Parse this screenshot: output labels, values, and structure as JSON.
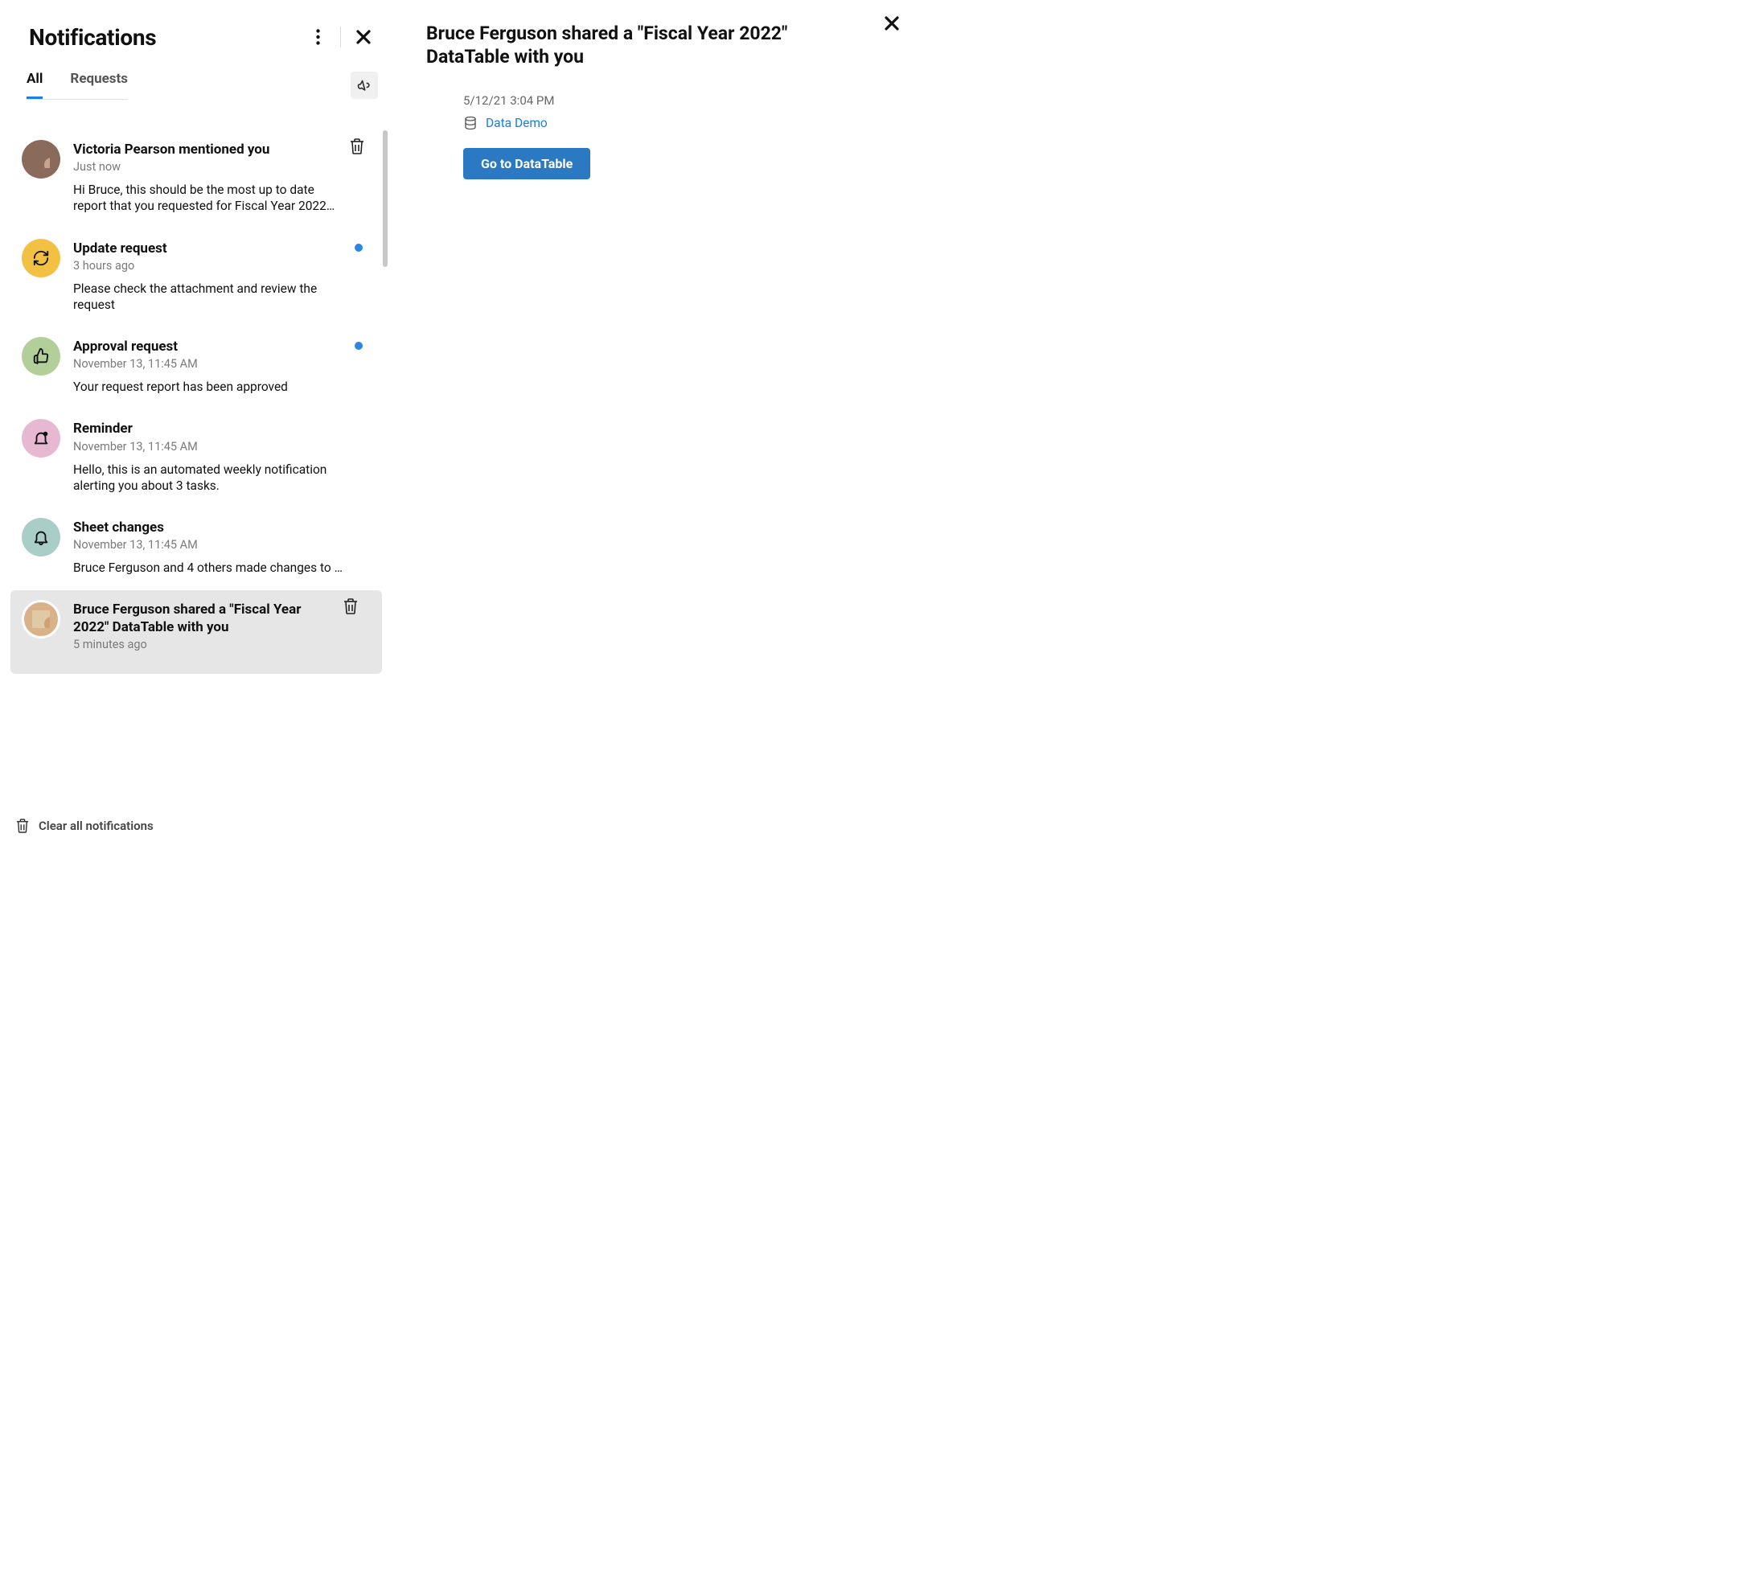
{
  "header": {
    "title": "Notifications"
  },
  "tabs": {
    "all": "All",
    "requests": "Requests"
  },
  "notifications": [
    {
      "title": "Victoria Pearson mentioned you",
      "time": "Just now",
      "body": "Hi Bruce, this should be the most up to date report that you requested for Fiscal Year 2022…",
      "avatarType": "photo",
      "unread": false,
      "showTrash": true
    },
    {
      "title": "Update request",
      "time": "3 hours ago",
      "body": "Please check the attachment and review the request",
      "avatarType": "yellow",
      "icon": "refresh",
      "unread": true
    },
    {
      "title": "Approval request",
      "time": "November 13, 11:45 AM",
      "body": "Your request report has been approved",
      "avatarType": "green",
      "icon": "thumb",
      "unread": true
    },
    {
      "title": "Reminder",
      "time": "November 13, 11:45 AM",
      "body": "Hello, this is an automated weekly notification alerting you about 3 tasks.",
      "avatarType": "pink",
      "icon": "reminder",
      "unread": false
    },
    {
      "title": "Sheet changes",
      "time": "November 13, 11:45 AM",
      "body": "Bruce Ferguson and 4 others made changes to …",
      "avatarType": "teal",
      "icon": "bell",
      "unread": false
    },
    {
      "title": "Bruce Ferguson shared a \"Fiscal Year 2022\" DataTable with you",
      "time": "5 minutes ago",
      "body": "",
      "avatarType": "photo2",
      "unread": false,
      "selected": true,
      "showTrash": true
    }
  ],
  "footer": {
    "clear_all": "Clear all notifications"
  },
  "detail": {
    "title": "Bruce Ferguson shared a \"Fiscal Year 2022\" DataTable with you",
    "timestamp": "5/12/21 3:04 PM",
    "link_label": "Data Demo",
    "cta": "Go to DataTable"
  }
}
